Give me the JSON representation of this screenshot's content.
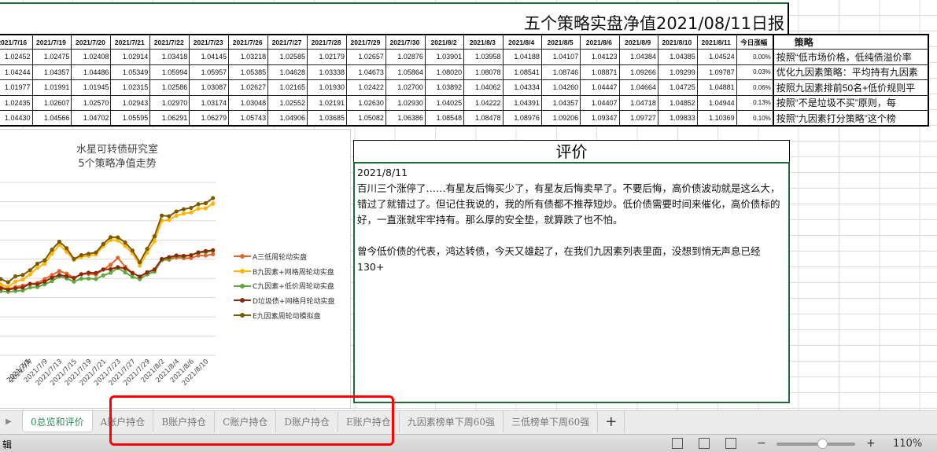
{
  "sheet_title": "五个策略实盘净值2021/08/11日报",
  "table": {
    "headers": [
      "2021/7/16",
      "2021/7/19",
      "2021/7/20",
      "2021/7/21",
      "2021/7/22",
      "2021/7/23",
      "2021/7/26",
      "2021/7/27",
      "2021/7/28",
      "2021/7/29",
      "2021/7/30",
      "2021/8/2",
      "2021/8/3",
      "2021/8/4",
      "2021/8/5",
      "2021/8/6",
      "2021/8/9",
      "2021/8/10",
      "2021/8/11"
    ],
    "pct_header": "今日涨幅",
    "strategy_header": "策略",
    "rows": [
      {
        "values": [
          "1.02452",
          "1.02475",
          "1.02408",
          "1.02914",
          "1.03418",
          "1.04145",
          "1.03218",
          "1.02585",
          "1.02179",
          "1.02657",
          "1.02876",
          "1.03901",
          "1.03958",
          "1.04188",
          "1.04107",
          "1.04123",
          "1.04384",
          "1.04385",
          "1.04524"
        ],
        "pct": "0.00%",
        "strategy": "按照“低市场价格，低纯债溢价率"
      },
      {
        "values": [
          "1.04244",
          "1.04357",
          "1.04486",
          "1.05349",
          "1.05994",
          "1.05957",
          "1.05385",
          "1.04628",
          "1.03338",
          "1.04673",
          "1.05864",
          "1.08020",
          "1.08078",
          "1.08541",
          "1.08746",
          "1.08871",
          "1.09266",
          "1.09299",
          "1.09787"
        ],
        "pct": "0.03%",
        "strategy": "优化九因素策略：平均持有九因素"
      },
      {
        "values": [
          "1.01977",
          "1.01991",
          "1.01945",
          "1.02315",
          "1.02586",
          "1.03087",
          "1.02627",
          "1.02165",
          "1.01930",
          "1.02422",
          "1.02700",
          "1.03892",
          "1.04062",
          "1.04334",
          "1.04260",
          "1.04447",
          "1.04664",
          "1.04725",
          "1.04881"
        ],
        "pct": "0.06%",
        "strategy": "按照九因素排前50名+低价规则平"
      },
      {
        "values": [
          "1.02435",
          "1.02607",
          "1.02570",
          "1.02943",
          "1.02970",
          "1.03174",
          "1.03048",
          "1.02552",
          "1.02191",
          "1.02630",
          "1.02930",
          "1.04025",
          "1.04222",
          "1.04391",
          "1.04357",
          "1.04407",
          "1.04718",
          "1.04852",
          "1.04944"
        ],
        "pct": "0.13%",
        "strategy": "按照“不是垃圾不买”原则，每"
      },
      {
        "values": [
          "1.04430",
          "1.04566",
          "1.04702",
          "1.05595",
          "1.06291",
          "1.06279",
          "1.05743",
          "1.04906",
          "1.03685",
          "1.05082",
          "1.06386",
          "1.08548",
          "1.08478",
          "1.08976",
          "1.09206",
          "1.09347",
          "1.09727",
          "1.09833",
          "1.10369"
        ],
        "pct": "0.10%",
        "strategy": "按照“九因素打分策略”这个榜"
      }
    ]
  },
  "chart_data": {
    "type": "line",
    "title": "水星可转债研究室",
    "subtitle": "5个策略净值走势",
    "x": [
      "2021/7/1",
      "2021/7/2",
      "2021/7/5",
      "2021/7/6",
      "2021/7/7",
      "2021/7/8",
      "2021/7/9",
      "2021/7/12",
      "2021/7/13",
      "2021/7/14",
      "2021/7/15",
      "2021/7/16",
      "2021/7/19",
      "2021/7/20",
      "2021/7/21",
      "2021/7/22",
      "2021/7/23",
      "2021/7/26",
      "2021/7/27",
      "2021/7/28",
      "2021/7/29",
      "2021/7/30",
      "2021/8/2",
      "2021/8/3",
      "2021/8/4",
      "2021/8/5",
      "2021/8/6",
      "2021/8/9",
      "2021/8/10",
      "2021/8/11"
    ],
    "tick_labels": [
      "2021/7/1",
      "2021/7/5",
      "2021/7/7",
      "2021/7/9",
      "2021/7/13",
      "2021/7/15",
      "2021/7/19",
      "2021/7/21",
      "2021/7/23",
      "2021/7/27",
      "2021/7/29",
      "2021/8/2",
      "2021/8/4",
      "2021/8/6",
      "2021/8/10"
    ],
    "ylim": [
      0.94,
      1.12
    ],
    "grid": true,
    "legend_position": "right",
    "series": [
      {
        "name": "A三低周轮动实盘",
        "color": "#e8622c",
        "values": [
          1.0111,
          1.0089,
          1.0111,
          1.0125,
          1.0144,
          1.0153,
          1.0194,
          1.0236,
          1.0278,
          1.025,
          1.0208,
          1.02452,
          1.02475,
          1.02408,
          1.02914,
          1.03418,
          1.04145,
          1.03218,
          1.02585,
          1.02179,
          1.02657,
          1.02876,
          1.03901,
          1.03958,
          1.04188,
          1.04107,
          1.04123,
          1.04384,
          1.04385,
          1.04524
        ]
      },
      {
        "name": "B九因素+网格周轮动实盘",
        "color": "#ffb400",
        "values": [
          1.0139,
          1.0111,
          1.0167,
          1.0189,
          1.0242,
          1.0311,
          1.0353,
          1.0458,
          1.055,
          1.0478,
          1.0394,
          1.04244,
          1.04357,
          1.04486,
          1.05349,
          1.05994,
          1.05957,
          1.05385,
          1.04628,
          1.03338,
          1.04673,
          1.05864,
          1.0802,
          1.08078,
          1.08541,
          1.08746,
          1.08871,
          1.09266,
          1.09299,
          1.09787
        ]
      },
      {
        "name": "C九因素+低价周轮动实盘",
        "color": "#5fa83a",
        "values": [
          1.0069,
          1.0061,
          1.0069,
          1.0075,
          1.0106,
          1.0111,
          1.0139,
          1.0172,
          1.0222,
          1.02,
          1.0167,
          1.01977,
          1.01991,
          1.01945,
          1.02315,
          1.02586,
          1.03087,
          1.02627,
          1.02165,
          1.0193,
          1.02422,
          1.027,
          1.03892,
          1.04062,
          1.04334,
          1.0426,
          1.04447,
          1.04664,
          1.04725,
          1.04881
        ]
      },
      {
        "name": "D垃圾债+网格月轮动实盘",
        "color": "#8a2a0a",
        "values": [
          1.0097,
          1.0083,
          1.0097,
          1.0106,
          1.0144,
          1.0139,
          1.0167,
          1.0208,
          1.0236,
          1.0222,
          1.0203,
          1.02435,
          1.02607,
          1.0257,
          1.02943,
          1.0297,
          1.03174,
          1.03048,
          1.02552,
          1.02191,
          1.0263,
          1.0293,
          1.04025,
          1.04222,
          1.04391,
          1.04357,
          1.04407,
          1.04718,
          1.04852,
          1.04944
        ]
      },
      {
        "name": "E九因素周轮动模拟盘",
        "color": "#7a5a00",
        "values": [
          1.0194,
          1.0161,
          1.0222,
          1.0236,
          1.0286,
          1.0353,
          1.0389,
          1.05,
          1.0583,
          1.0514,
          1.0403,
          1.0443,
          1.04566,
          1.04702,
          1.05595,
          1.06291,
          1.06279,
          1.05743,
          1.04906,
          1.03685,
          1.05082,
          1.06386,
          1.08548,
          1.08478,
          1.08976,
          1.09206,
          1.09347,
          1.09727,
          1.09833,
          1.10369
        ]
      }
    ]
  },
  "evaluation": {
    "heading": "评价",
    "paragraphs": [
      "2021/8/11",
      "百川三个涨停了……有星友后悔买少了，有星友后悔卖早了。不要后悔，高价债波动就是这么大，错过了就错过了。但记住我说的，我的所有债都不推荐短炒。低价债需要时间来催化，高价债标的好，一直涨就牢牢持有。那么厚的安全垫，就算跌了也不怕。",
      "",
      "曾今低价债的代表，鸿达转债，今天又雄起了，在我们九因素列表里面，没想到悄无声息已经130+"
    ]
  },
  "tabs": [
    "0总览和评价",
    "A账户持仓",
    "B账户持仓",
    "C账户持仓",
    "D账户持仓",
    "E账户持仓",
    "九因素榜单下周60强",
    "三低榜单下周60强"
  ],
  "active_tab": "0总览和评价",
  "add_tab": "+",
  "status": {
    "mode": "辑",
    "zoom": "110%",
    "zoom_fraction": 0.58,
    "zoom_minus": "−",
    "zoom_plus": "+"
  },
  "highlight_color": "#ff0000"
}
